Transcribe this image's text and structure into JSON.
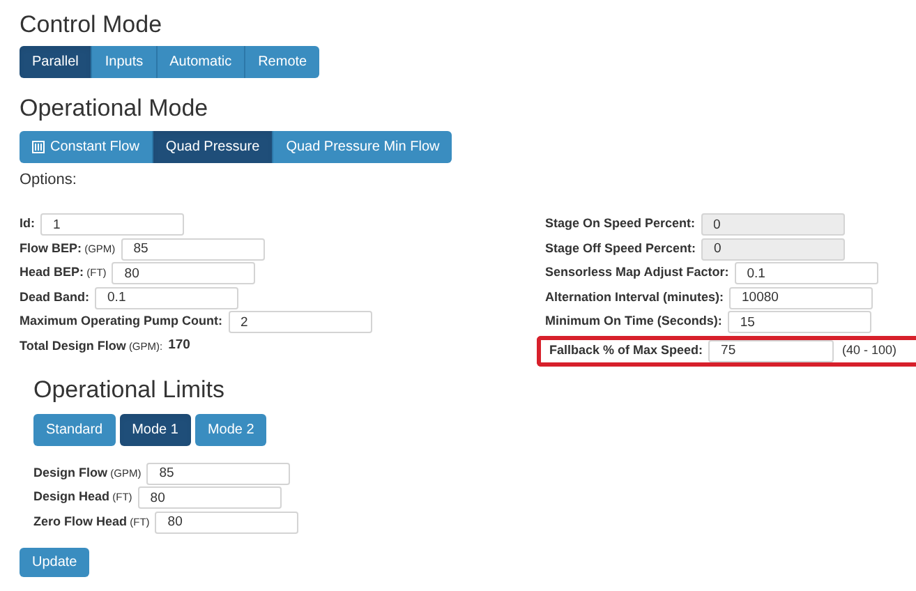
{
  "control_mode": {
    "title": "Control Mode",
    "buttons": [
      {
        "label": "Parallel",
        "selected": true
      },
      {
        "label": "Inputs",
        "selected": false
      },
      {
        "label": "Automatic",
        "selected": false
      },
      {
        "label": "Remote",
        "selected": false
      }
    ]
  },
  "operational_mode": {
    "title": "Operational Mode",
    "buttons": [
      {
        "label": "Constant Flow",
        "selected": false,
        "icon": true
      },
      {
        "label": "Quad Pressure",
        "selected": true,
        "icon": false
      },
      {
        "label": "Quad Pressure Min Flow",
        "selected": false,
        "icon": false
      }
    ]
  },
  "options_label": "Options:",
  "left_fields": [
    {
      "kind": "input",
      "label": "Id:",
      "value": "1"
    },
    {
      "kind": "input",
      "label": "Flow BEP:",
      "unit": "(GPM)",
      "value": "85"
    },
    {
      "kind": "input",
      "label": "Head BEP:",
      "unit": "(FT)",
      "value": "80"
    },
    {
      "kind": "input",
      "label": "Dead Band:",
      "value": "0.1"
    },
    {
      "kind": "input",
      "label": "Maximum Operating Pump Count:",
      "value": "2"
    },
    {
      "kind": "text",
      "label": "Total Design Flow",
      "unit": "(GPM):",
      "value": "170"
    }
  ],
  "right_fields": [
    {
      "label": "Stage On Speed Percent:",
      "value": "0",
      "disabled": true,
      "highlighted": false
    },
    {
      "label": "Stage Off Speed Percent:",
      "value": "0",
      "disabled": true,
      "highlighted": false
    },
    {
      "label": "Sensorless Map Adjust Factor:",
      "value": "0.1",
      "disabled": false,
      "highlighted": false
    },
    {
      "label": "Alternation Interval (minutes):",
      "value": "10080",
      "disabled": false,
      "highlighted": false
    },
    {
      "label": "Minimum On Time (Seconds):",
      "value": "15",
      "disabled": false,
      "highlighted": false
    },
    {
      "label": "Fallback % of Max Speed:",
      "value": "75",
      "range": "(40 - 100)",
      "disabled": false,
      "highlighted": true
    }
  ],
  "operational_limits": {
    "title": "Operational Limits",
    "buttons": [
      {
        "label": "Standard",
        "selected": false
      },
      {
        "label": "Mode 1",
        "selected": true
      },
      {
        "label": "Mode 2",
        "selected": false
      }
    ],
    "fields": [
      {
        "label": "Design Flow",
        "unit": "(GPM)",
        "value": "85"
      },
      {
        "label": "Design Head",
        "unit": "(FT)",
        "value": "80"
      },
      {
        "label": "Zero Flow Head",
        "unit": "(FT)",
        "value": "80"
      }
    ]
  },
  "update_button": "Update"
}
